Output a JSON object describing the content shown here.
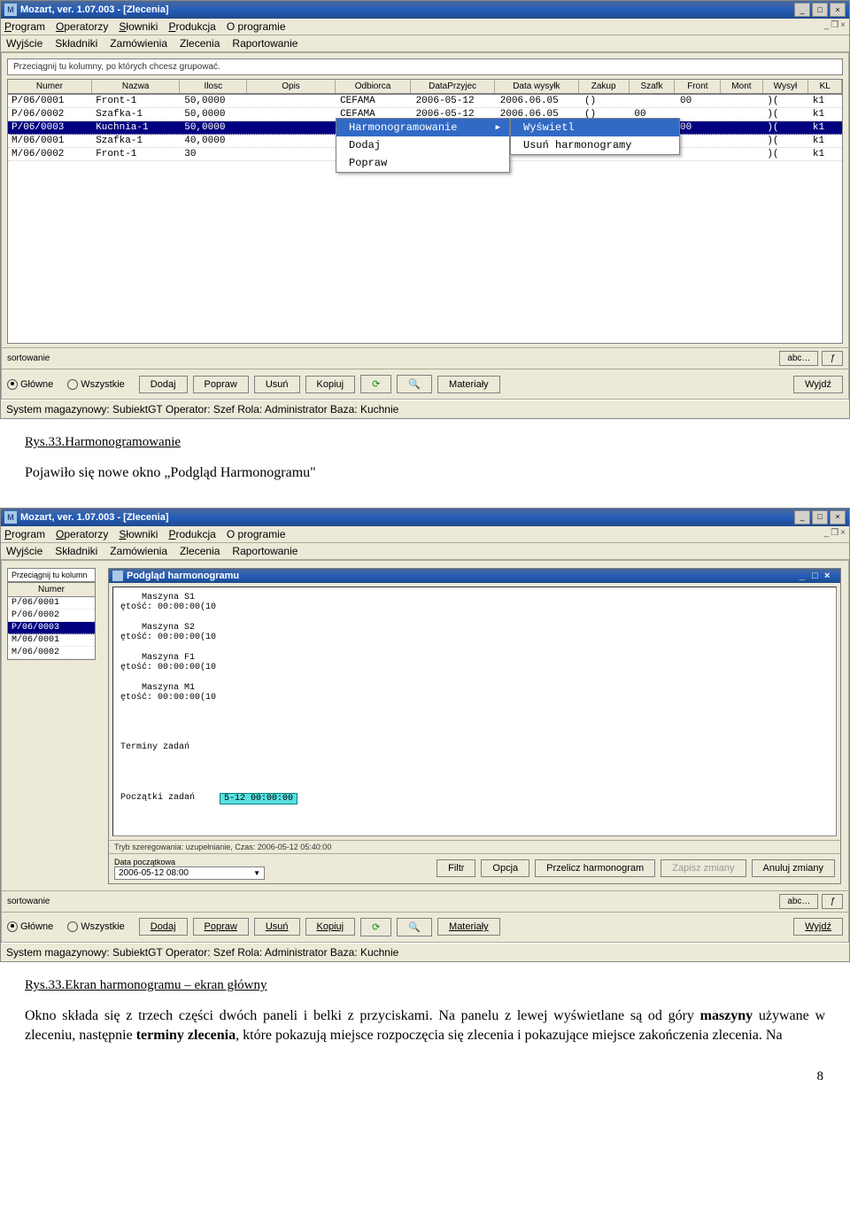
{
  "shot1": {
    "title": "Mozart, ver. 1.07.003 - [Zlecenia]",
    "menu1": [
      "Program",
      "Operatorzy",
      "Słowniki",
      "Produkcja",
      "O programie"
    ],
    "menu2": [
      "Wyjście",
      "Składniki",
      "Zamówienia",
      "Zlecenia",
      "Raportowanie"
    ],
    "grouphint": "Przeciągnij tu kolumny, po których chcesz grupować.",
    "cols": [
      "Numer",
      "Nazwa",
      "Ilosc",
      "Opis",
      "Odbiorca",
      "DataPrzyjec",
      "Data wysyłk",
      "Zakup",
      "Szafk",
      "Front",
      "Mont",
      "Wysył",
      "KL"
    ],
    "rows": [
      {
        "c": [
          "P/06/0001",
          "Front-1",
          "50,0000",
          "",
          "CEFAMA",
          "2006-05-12",
          "2006.06.05",
          "()",
          "",
          "00",
          "",
          ")(",
          "k1"
        ]
      },
      {
        "c": [
          "P/06/0002",
          "Szafka-1",
          "50,0000",
          "",
          "CEFAMA",
          "2006-05-12",
          "2006.06.05",
          "()",
          "00",
          "",
          "",
          ")(",
          "k1"
        ]
      },
      {
        "c": [
          "P/06/0003",
          "Kuchnia-1",
          "50,0000",
          "",
          "",
          "",
          "",
          "",
          "",
          "00",
          "",
          ")(",
          "k1"
        ],
        "sel": true
      },
      {
        "c": [
          "M/06/0001",
          "Szafka-1",
          "40,0000",
          "",
          "",
          "",
          "",
          "",
          "",
          "",
          "",
          ")(",
          "k1"
        ]
      },
      {
        "c": [
          "M/06/0002",
          "Front-1",
          "30",
          "",
          "",
          "",
          "",
          "",
          "",
          "",
          "",
          ")(",
          "k1"
        ]
      }
    ],
    "ctx1": [
      {
        "t": "Harmonogramowanie",
        "hl": true,
        "arrow": true
      },
      {
        "t": "Dodaj"
      },
      {
        "t": "Popraw"
      }
    ],
    "ctx2": [
      {
        "t": "Wyświetl",
        "hl": true
      },
      {
        "t": "Usuń harmonogramy"
      }
    ],
    "sort_label": "sortowanie",
    "abc_btn": "abc…",
    "radios": [
      "Główne",
      "Wszystkie"
    ],
    "buttons": [
      "Dodaj",
      "Popraw",
      "Usuń",
      "Kopiuj"
    ],
    "iconbtns": [
      "↻",
      "🔍"
    ],
    "mat_btn": "Materiały",
    "exit_btn": "Wyjdź",
    "status": "System magazynowy: SubiektGT  Operator: Szef  Rola: Administrator  Baza: Kuchnie"
  },
  "doc1_caption": "Rys.33.Harmonogramowanie",
  "doc1_para": "Pojawiło się nowe okno „Podgląd Harmonogramu\"",
  "shot2": {
    "title": "Mozart, ver. 1.07.003 - [Zlecenia]",
    "menu1": [
      "Program",
      "Operatorzy",
      "Słowniki",
      "Produkcja",
      "O programie"
    ],
    "menu2": [
      "Wyjście",
      "Składniki",
      "Zamówienia",
      "Zlecenia",
      "Raportowanie"
    ],
    "grouphint": "Przeciągnij tu kolumn",
    "leftcol": "Numer",
    "leftrows": [
      "P/06/0001",
      "P/06/0002",
      "P/06/0003",
      "M/06/0001",
      "M/06/0002"
    ],
    "leftsel": 2,
    "inner_title": "Podgląd harmonogramu",
    "machines": [
      {
        "n": "Maszyna S1",
        "d": "ętość: 00:00:00(10"
      },
      {
        "n": "Maszyna S2",
        "d": "ętość: 00:00:00(10"
      },
      {
        "n": "Maszyna F1",
        "d": "ętość: 00:00:00(10"
      },
      {
        "n": "Maszyna M1",
        "d": "ętość: 00:00:00(10"
      }
    ],
    "terms_label": "Terminy zadań",
    "starts_label": "Początki zadań",
    "cyan_text": "5-12 00:00:00",
    "info": "Tryb szeregowania: uzupełnianie, Czas: 2006-05-12 05:40:00",
    "date_label": "Data początkowa",
    "date_val": "2006-05-12 08:00",
    "ibuttons": [
      "Filtr",
      "Opcja",
      "Przelicz harmonogram",
      "Zapisz zmiany",
      "Anuluj zmiany"
    ],
    "sort_label": "sortowanie",
    "abc_btn": "abc…",
    "radios": [
      "Główne",
      "Wszystkie"
    ],
    "buttons": [
      "Dodaj",
      "Popraw",
      "Usuń",
      "Kopiuj"
    ],
    "mat_btn": "Materiały",
    "exit_btn": "Wyjdź",
    "status": "System magazynowy: SubiektGT  Operator: Szef  Rola: Administrator  Baza: Kuchnie"
  },
  "doc2_caption": "Rys.33.Ekran harmonogramu – ekran główny",
  "doc2_para": "Okno składa się z trzech części dwóch paneli i belki z przyciskami. Na panelu z lewej wyświetlane są od góry maszyny używane w zleceniu, następnie terminy zlecenia, które pokazują miejsce rozpoczęcia się zlecenia  i  pokazujące miejsce zakończenia zlecenia. Na",
  "doc2_bold": [
    "maszyny",
    "terminy zlecenia"
  ],
  "pagenum": "8"
}
